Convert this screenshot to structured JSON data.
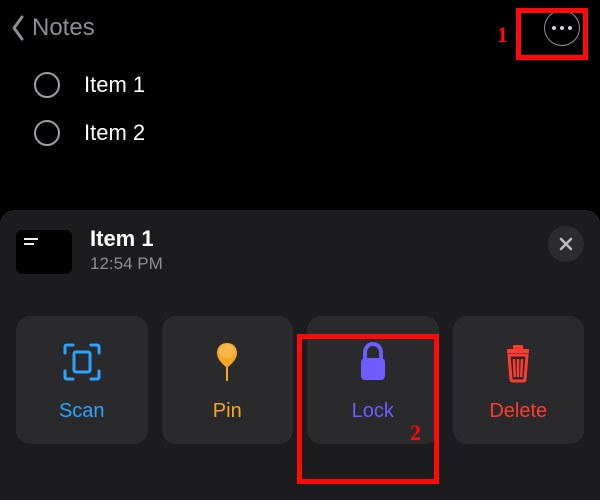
{
  "nav": {
    "back_label": "Notes"
  },
  "list": {
    "items": [
      {
        "label": "Item 1"
      },
      {
        "label": "Item 2"
      }
    ]
  },
  "sheet": {
    "title": "Item 1",
    "subtitle": "12:54 PM",
    "actions": {
      "scan": {
        "label": "Scan"
      },
      "pin": {
        "label": "Pin"
      },
      "lock": {
        "label": "Lock"
      },
      "delete": {
        "label": "Delete"
      }
    }
  },
  "annotations": {
    "step1": "1",
    "step2": "2"
  }
}
